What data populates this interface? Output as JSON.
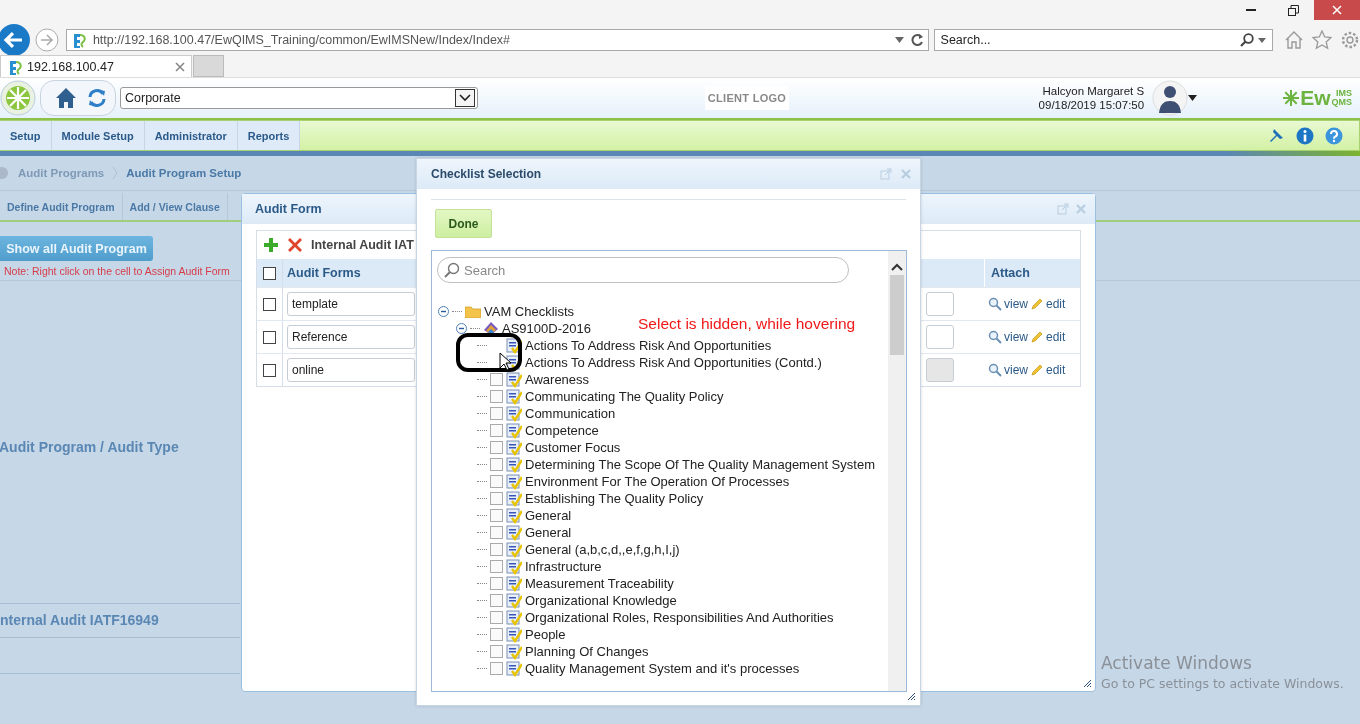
{
  "browser": {
    "url": "http://192.168.100.47/EwQIMS_Training/common/EwIMSNew/Index/Index#",
    "search_placeholder": "Search...",
    "tab_title": "192.168.100.47"
  },
  "header": {
    "location": "Corporate",
    "client_logo": "CLIENT LOGO",
    "user_name": "Halcyon Margaret S",
    "datetime": "09/18/2019 15:07:50",
    "brand_main": "Ew",
    "brand_sup": "IMS",
    "brand_sub": "QMS"
  },
  "menu": [
    {
      "label": "Setup"
    },
    {
      "label": "Module Setup"
    },
    {
      "label": "Administrator"
    },
    {
      "label": "Reports"
    }
  ],
  "breadcrumb": [
    "Audit Programs",
    "Audit Program Setup"
  ],
  "page_tabs": [
    {
      "label": "Define Audit Program"
    },
    {
      "label": "Add / View Clause"
    }
  ],
  "show_all_button": "Show all Audit Program",
  "note": "Note: Right click on the cell to Assign Audit Form",
  "sections": [
    "Audit Program / Audit Type",
    "nternal Audit IATF16949"
  ],
  "audit_form": {
    "title": "Audit Form",
    "toolbar_title": "Internal Audit IAT",
    "header_checked": false,
    "columns": [
      "Audit Forms",
      "Attach"
    ],
    "rows": [
      {
        "form": "template",
        "checked": false,
        "second_field_disabled": false,
        "view": "view",
        "edit": "edit"
      },
      {
        "form": "Reference",
        "checked": false,
        "second_field_disabled": false,
        "view": "view",
        "edit": "edit"
      },
      {
        "form": "online",
        "checked": false,
        "second_field_disabled": true,
        "view": "view",
        "edit": "edit"
      }
    ]
  },
  "checklist": {
    "title": "Checklist Selection",
    "done": "Done",
    "search_placeholder": "Search",
    "tree": [
      {
        "label": "VAM Checklists",
        "kind": "folder",
        "expanded": true,
        "children": [
          {
            "label": "AS9100D-2016",
            "kind": "standard",
            "expanded": true,
            "children": [
              {
                "label": "Actions To Address Risk And Opportunities",
                "kind": "checklist",
                "checkbox_visible": false
              },
              {
                "label": "Actions To Address Risk And Opportunities (Contd.)",
                "kind": "checklist",
                "checkbox_visible": false
              },
              {
                "label": "Awareness",
                "kind": "checklist",
                "checked": false,
                "checkbox_visible": true
              },
              {
                "label": "Communicating The Quality Policy",
                "kind": "checklist",
                "checked": false,
                "checkbox_visible": true
              },
              {
                "label": "Communication",
                "kind": "checklist",
                "checked": false,
                "checkbox_visible": true
              },
              {
                "label": "Competence",
                "kind": "checklist",
                "checked": false,
                "checkbox_visible": true
              },
              {
                "label": "Customer Focus",
                "kind": "checklist",
                "checked": false,
                "checkbox_visible": true
              },
              {
                "label": "Determining The Scope Of The Quality Management System",
                "kind": "checklist",
                "checked": false,
                "checkbox_visible": true
              },
              {
                "label": "Environment For The Operation Of Processes",
                "kind": "checklist",
                "checked": false,
                "checkbox_visible": true
              },
              {
                "label": "Establishing The Quality Policy",
                "kind": "checklist",
                "checked": false,
                "checkbox_visible": true
              },
              {
                "label": "General",
                "kind": "checklist",
                "checked": false,
                "checkbox_visible": true
              },
              {
                "label": "General",
                "kind": "checklist",
                "checked": false,
                "checkbox_visible": true
              },
              {
                "label": "General (a,b,c,d,,e,f,g,h,I,j)",
                "kind": "checklist",
                "checked": false,
                "checkbox_visible": true
              },
              {
                "label": "Infrastructure",
                "kind": "checklist",
                "checked": false,
                "checkbox_visible": true
              },
              {
                "label": "Measurement Traceability",
                "kind": "checklist",
                "checked": false,
                "checkbox_visible": true
              },
              {
                "label": "Organizational Knowledge",
                "kind": "checklist",
                "checked": false,
                "checkbox_visible": true
              },
              {
                "label": "Organizational Roles, Responsibilities And Authorities",
                "kind": "checklist",
                "checked": false,
                "checkbox_visible": true
              },
              {
                "label": "People",
                "kind": "checklist",
                "checked": false,
                "checkbox_visible": true
              },
              {
                "label": "Planning Of Changes",
                "kind": "checklist",
                "checked": false,
                "checkbox_visible": true
              },
              {
                "label": "Quality Management System and it's processes",
                "kind": "checklist",
                "checked": false,
                "checkbox_visible": true
              }
            ]
          }
        ]
      }
    ]
  },
  "annotation": {
    "text": "Select is hidden, while hovering"
  },
  "watermark": {
    "title": "Activate Windows",
    "subtitle": "Go to PC settings to activate Windows."
  }
}
